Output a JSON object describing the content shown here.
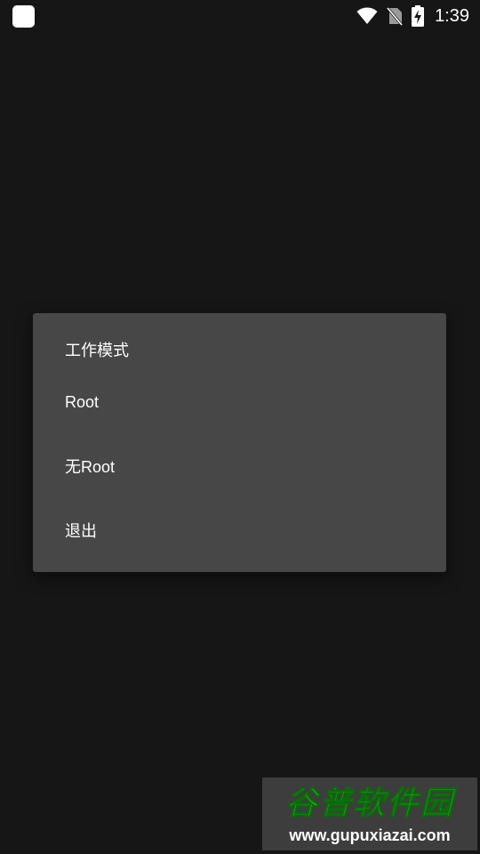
{
  "status_bar": {
    "time": "1:39",
    "icons": [
      "app-icon",
      "wifi-icon",
      "no-sim-icon",
      "battery-charging-icon"
    ]
  },
  "dialog": {
    "title": "工作模式",
    "options": [
      {
        "label": "Root"
      },
      {
        "label": "无Root"
      },
      {
        "label": "退出"
      }
    ]
  },
  "watermark": {
    "logo_text": "谷普软件园",
    "url": "www.gupuxiazai.com",
    "logo_color": "#22c01f"
  },
  "colors": {
    "background": "#161616",
    "dialog_bg": "#474747",
    "text": "#ffffff"
  }
}
